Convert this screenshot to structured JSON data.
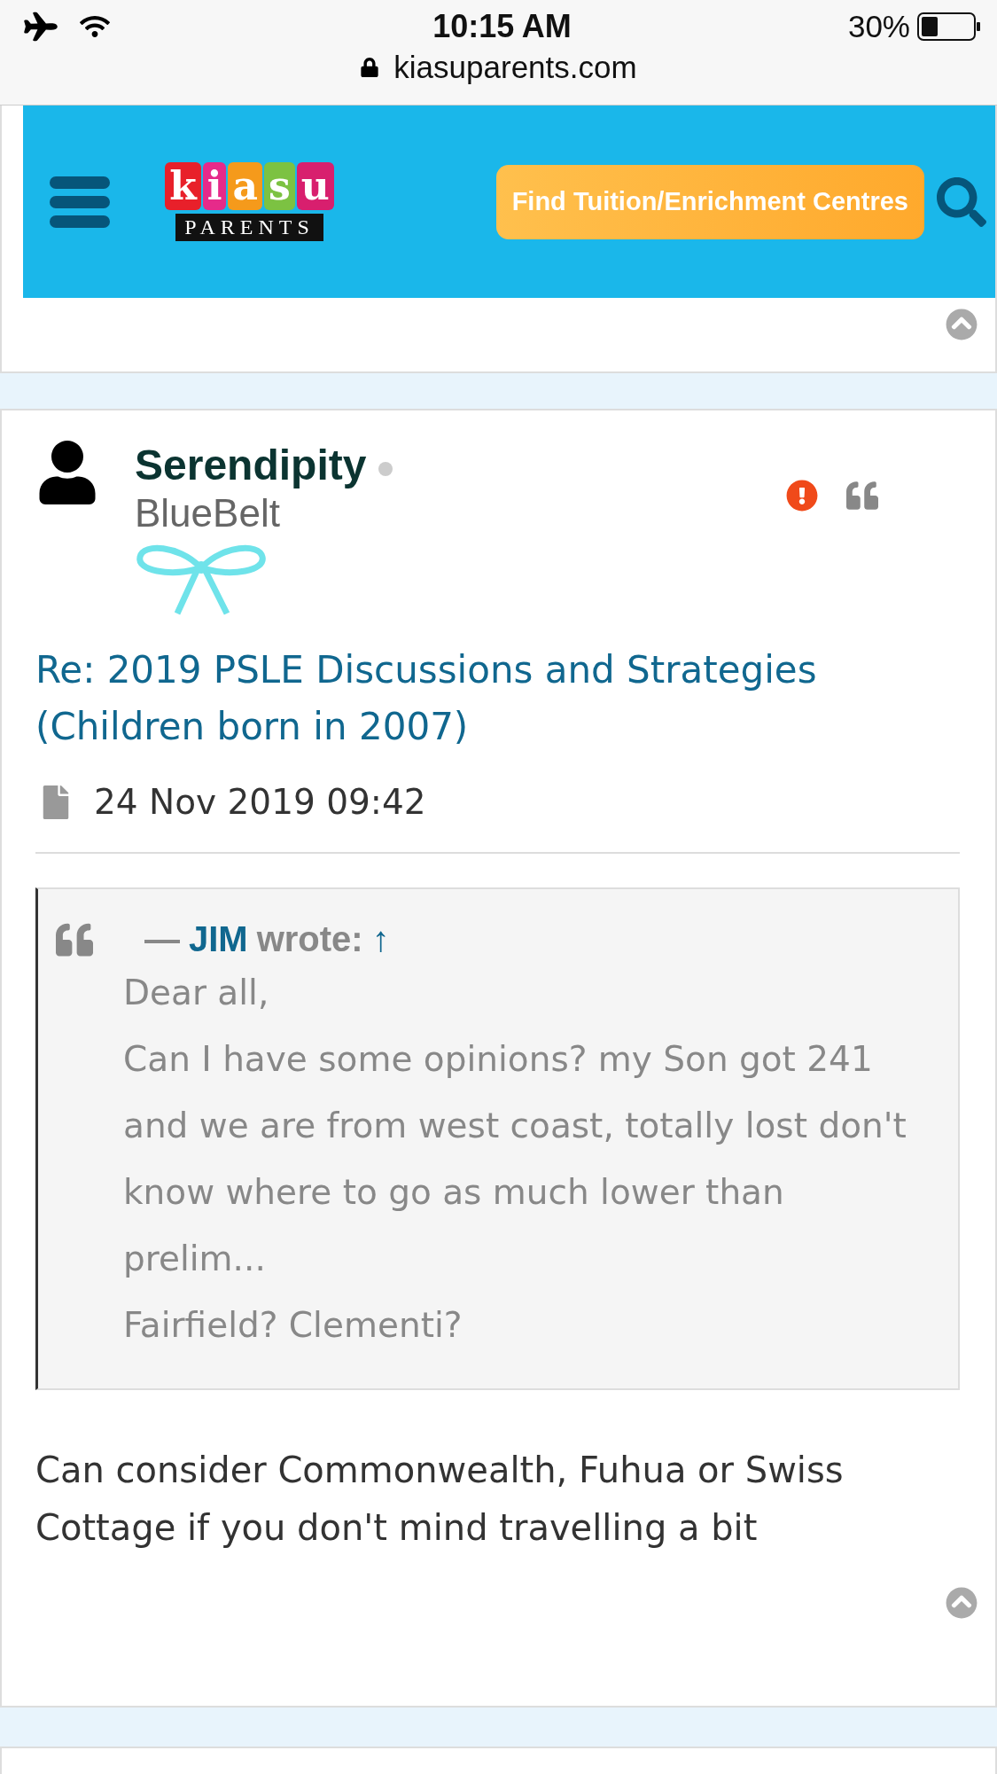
{
  "status_bar": {
    "time": "10:15 AM",
    "battery": "30%",
    "url": "kiasuparents.com"
  },
  "header": {
    "logo": {
      "wordmark": "kiasu",
      "tagline": "PARENTS"
    },
    "cta": "Find Tuition/Enrichment Centres"
  },
  "post": {
    "author": "Serendipity",
    "online": false,
    "rank": "BlueBelt",
    "title": "Re: 2019 PSLE Discussions and Strategies (Children born in 2007)",
    "date": "24 Nov 2019 09:42",
    "quote": {
      "dash": "—",
      "author": "JIM",
      "wrote": "wrote:",
      "arrow": "↑",
      "lines": [
        "Dear all,",
        "Can I have some opinions? my Son got 241 and we are from west coast, totally lost don't know where to go as much lower than prelim...",
        "Fairfield? Clementi?"
      ]
    },
    "body": "Can consider Commonwealth, Fuhua or Swiss Cottage if you don't mind travelling a bit"
  }
}
